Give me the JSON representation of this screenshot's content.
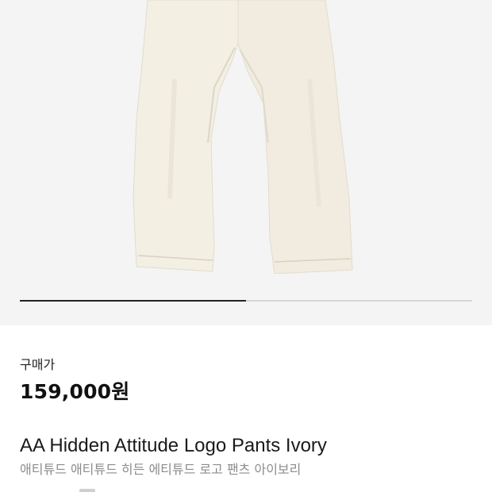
{
  "product": {
    "image_alt": "ivory pants photo",
    "price_label": "구매가",
    "price": "159,000원",
    "name_en": "AA Hidden Attitude Logo Pants Ivory",
    "name_ko": "애티튜드 애티튜드 히든 에티튜드 로고 팬츠 아이보리"
  },
  "gallery": {
    "progress_fraction": 0.5
  },
  "colors": {
    "image_background": "#f4f4f4",
    "pants": "#f3efe3",
    "progress_fill": "#222222",
    "progress_track": "#d6d6d6",
    "subtitle": "#8c8c8c"
  }
}
